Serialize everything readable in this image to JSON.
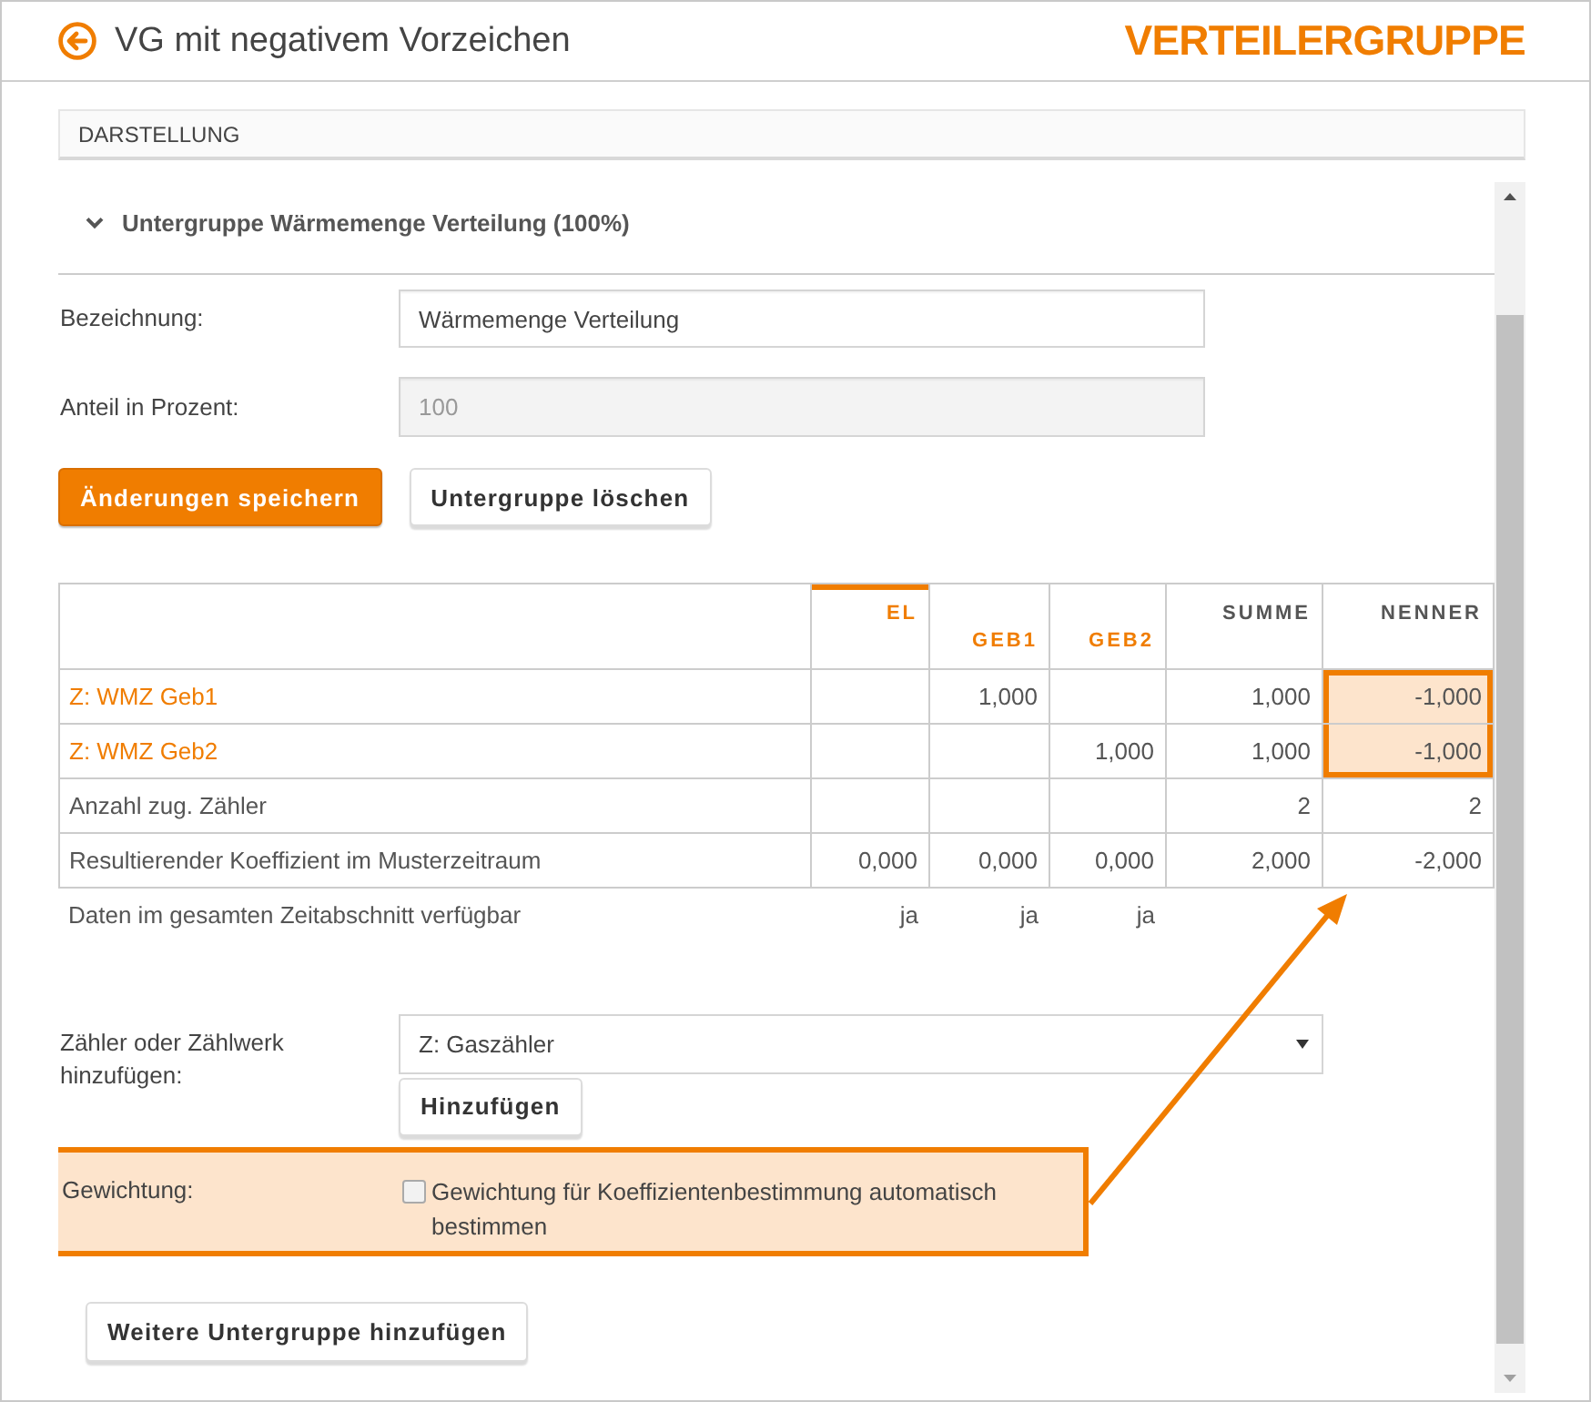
{
  "header": {
    "title": "VG mit negativem Vorzeichen",
    "section": "VERTEILERGRUPPE"
  },
  "display_bar": {
    "label": "DARSTELLUNG"
  },
  "subgroup": {
    "title": "Untergruppe Wärmemenge Verteilung (100%)",
    "expanded": true,
    "fields": [
      {
        "label": "Bezeichnung:",
        "value": "Wärmemenge Verteilung",
        "disabled": false
      },
      {
        "label": "Anteil in Prozent:",
        "value": "100",
        "disabled": true
      }
    ],
    "buttons": [
      {
        "label": "Änderungen speichern",
        "kind": "primary"
      },
      {
        "label": "Untergruppe löschen",
        "kind": "secondary"
      }
    ],
    "table": {
      "columns": [
        {
          "label": "EL",
          "kind": "meter",
          "selected": true
        },
        {
          "label": "GEB1",
          "kind": "submeter",
          "selected": false
        },
        {
          "label": "GEB2",
          "kind": "submeter",
          "selected": false
        },
        {
          "label": "SUMME",
          "kind": "total",
          "selected": false
        },
        {
          "label": "NENNER",
          "kind": "total",
          "selected": false
        }
      ],
      "rows": [
        {
          "kind": "meter",
          "label": "Z: WMZ Geb1",
          "cells": [
            {
              "highlighted": false
            },
            {
              "text": "1,000",
              "highlighted": false
            },
            {
              "highlighted": false
            },
            {
              "text": "1,000",
              "highlighted": false
            },
            {
              "text": "-1,000",
              "highlighted": true
            }
          ]
        },
        {
          "kind": "meter",
          "label": "Z: WMZ Geb2",
          "cells": [
            {
              "highlighted": false
            },
            {
              "highlighted": false
            },
            {
              "text": "1,000",
              "highlighted": false
            },
            {
              "text": "1,000",
              "highlighted": false
            },
            {
              "text": "-1,000",
              "highlighted": true
            }
          ]
        },
        {
          "kind": "summary",
          "label": "Anzahl zug. Zähler",
          "cells": [
            {
              "highlighted": false
            },
            {
              "highlighted": false
            },
            {
              "highlighted": false
            },
            {
              "text": "2",
              "highlighted": false
            },
            {
              "text": "2",
              "highlighted": false
            }
          ]
        },
        {
          "kind": "summary",
          "label": "Resultierender Koeffizient im Musterzeitraum",
          "cells": [
            {
              "text": "0,000",
              "highlighted": false
            },
            {
              "text": "0,000",
              "highlighted": false
            },
            {
              "text": "0,000",
              "highlighted": false
            },
            {
              "text": "2,000",
              "highlighted": false
            },
            {
              "text": "-2,000",
              "highlighted": false
            }
          ]
        },
        {
          "kind": "note",
          "label": "Daten im gesamten Zeitabschnitt verfügbar",
          "cells": [
            {
              "text": "ja",
              "highlighted": false
            },
            {
              "text": "ja",
              "highlighted": false
            },
            {
              "text": "ja",
              "highlighted": false
            },
            {
              "highlighted": false
            },
            {
              "highlighted": false
            }
          ]
        }
      ]
    },
    "add_meter": {
      "label": "Zähler oder Zählwerk hinzufügen:",
      "value": "Z: Gaszähler",
      "button": "Hinzufügen"
    },
    "weighting": {
      "label": "Gewichtung:",
      "option": "Gewichtung für Koeffizientenbestimmung automatisch bestimmen",
      "checked": false,
      "highlighted": true
    }
  },
  "add_subgroup_button": "Weitere Untergruppe hinzufügen",
  "callout_arrow": true
}
